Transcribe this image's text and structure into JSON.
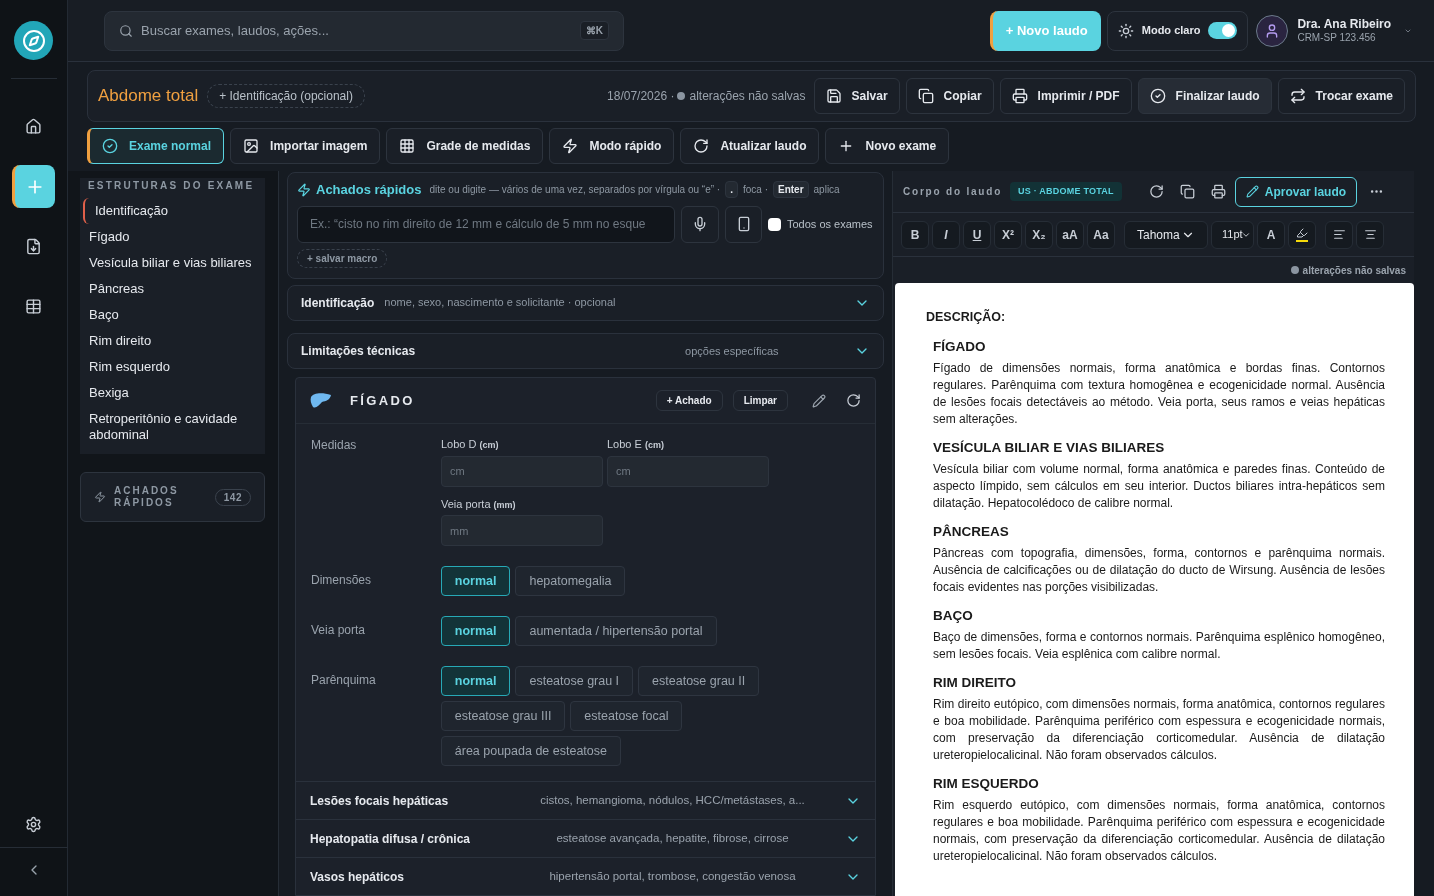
{
  "search": {
    "placeholder": "Buscar exames, laudos, ações...",
    "shortcut": "⌘K"
  },
  "topbar": {
    "new_button": "+ Novo laudo",
    "theme_toggle": {
      "label": "Modo claro",
      "on": true
    },
    "user": {
      "name": "Dra. Ana Ribeiro",
      "subtitle": "CRM-SP 123.456"
    }
  },
  "rail": [
    {
      "kind": "home",
      "selected": false
    },
    {
      "kind": "plus",
      "selected": true
    },
    {
      "kind": "file",
      "selected": false
    },
    {
      "kind": "table",
      "selected": false
    }
  ],
  "header": {
    "title": "Abdome total",
    "id_chip": "+ Identificação (opcional)",
    "date": "18/07/2026 ·",
    "status": "alterações não salvas",
    "buttons": [
      {
        "kind": "save",
        "label": "Salvar"
      },
      {
        "kind": "copy",
        "label": "Copiar"
      },
      {
        "kind": "print",
        "label": "Imprimir / PDF"
      },
      {
        "kind": "check",
        "label": "Finalizar laudo"
      },
      {
        "kind": "swap",
        "label": "Trocar exame"
      }
    ]
  },
  "actions": [
    {
      "kind": "check",
      "label": "Exame normal",
      "selected": true
    },
    {
      "kind": "image",
      "label": "Importar imagem",
      "selected": false
    },
    {
      "kind": "grid",
      "label": "Grade de medidas",
      "selected": false
    },
    {
      "kind": "bolt",
      "label": "Modo rápido",
      "selected": false
    },
    {
      "kind": "refresh",
      "label": "Atualizar laudo",
      "selected": false
    },
    {
      "kind": "plus",
      "label": "Novo exame",
      "selected": false
    }
  ],
  "structures": {
    "title": "ESTRUTURAS DO EXAME",
    "items": [
      {
        "label": "Identificação",
        "selected": true
      },
      {
        "label": "Fígado",
        "selected": false
      },
      {
        "label": "Vesícula biliar e vias biliares",
        "selected": false
      },
      {
        "label": "Pâncreas",
        "selected": false
      },
      {
        "label": "Baço",
        "selected": false
      },
      {
        "label": "Rim direito",
        "selected": false
      },
      {
        "label": "Rim esquerdo",
        "selected": false
      },
      {
        "label": "Bexiga",
        "selected": false
      },
      {
        "label": "Retroperitônio e cavidade abdominal",
        "selected": false
      }
    ],
    "quick": {
      "label": "ACHADOS RÁPIDOS",
      "count": "142"
    }
  },
  "quick_findings": {
    "title": "Achados rápidos",
    "hint": "dite ou digite — vários de uma vez, separados por vírgula ou “e” ·",
    "key1": ".",
    "hint2": "foca ·",
    "key2": "Enter",
    "hint3": "aplica",
    "placeholder": "Ex.: “cisto no rim direito de 12 mm e cálculo de 5 mm no esque",
    "all_exams": {
      "label": "Todos os exames",
      "checked": false
    },
    "macro": "+ salvar macro"
  },
  "sections": [
    {
      "title": "Identificação",
      "hint": "nome, sexo, nascimento e solicitante · opcional",
      "expanded": false
    },
    {
      "title": "Limitações técnicas",
      "hint": "opções específicas",
      "expanded": false
    }
  ],
  "organ": {
    "title": "FÍGADO",
    "add": "+ Achado",
    "clear": "Limpar",
    "measures_label": "Medidas",
    "measures": [
      {
        "label": "Lobo D",
        "unit": "(cm)",
        "placeholder": "cm"
      },
      {
        "label": "Lobo E",
        "unit": "(cm)",
        "placeholder": "cm"
      },
      {
        "label": "Veia porta",
        "unit": "(mm)",
        "placeholder": "mm"
      }
    ],
    "groups": [
      {
        "label": "Dimensões",
        "options": [
          {
            "label": "normal",
            "selected": true
          },
          {
            "label": "hepatomegalia",
            "selected": false
          }
        ]
      },
      {
        "label": "Veia porta",
        "options": [
          {
            "label": "normal",
            "selected": true
          },
          {
            "label": "aumentada / hipertensão portal",
            "selected": false
          }
        ]
      },
      {
        "label": "Parênquima",
        "options": [
          {
            "label": "normal",
            "selected": true
          },
          {
            "label": "esteatose grau I",
            "selected": false
          },
          {
            "label": "esteatose grau II",
            "selected": false
          },
          {
            "label": "esteatose grau III",
            "selected": false
          },
          {
            "label": "esteatose focal",
            "selected": false
          },
          {
            "label": "área poupada de esteatose",
            "selected": false
          }
        ]
      }
    ],
    "subsections": [
      {
        "title": "Lesões focais hepáticas",
        "hint": "cistos, hemangioma, nódulos, HCC/metástases, a...",
        "expanded": false
      },
      {
        "title": "Hepatopatia difusa / crônica",
        "hint": "esteatose avançada, hepatite, fibrose, cirrose",
        "expanded": false
      },
      {
        "title": "Vasos hepáticos",
        "hint": "hipertensão portal, trombose, congestão venosa",
        "expanded": false
      }
    ]
  },
  "editor": {
    "title": "Corpo do laudo",
    "tag": "US · ABDOME TOTAL",
    "approve": "Aprovar laudo",
    "format_buttons": [
      "B",
      "I",
      "U",
      "X²",
      "X₂",
      "aA",
      "Aa"
    ],
    "font": "Tahoma",
    "size": "11pt",
    "color_button": "A",
    "status": "alterações não salvas",
    "document": {
      "heading": "DESCRIÇÃO:",
      "sections": [
        {
          "title": "FÍGADO",
          "text": "Fígado de dimensões normais, forma anatômica e bordas finas. Contornos regulares. Parênquima com textura homogênea e ecogenicidade normal. Ausência de lesões focais detectáveis ao método. Veia porta, seus ramos e veias hepáticas sem alterações."
        },
        {
          "title": "VESÍCULA BILIAR E VIAS BILIARES",
          "text": "Vesícula biliar com volume normal, forma anatômica e paredes finas. Conteúdo de aspecto límpido, sem cálculos em seu interior. Ductos biliares intra-hepáticos sem dilatação. Hepatocolédoco de calibre normal."
        },
        {
          "title": "PÂNCREAS",
          "text": "Pâncreas com topografia, dimensões, forma, contornos e parênquima normais. Ausência de calcificações ou de dilatação do ducto de Wirsung. Ausência de lesões focais evidentes nas porções visibilizadas."
        },
        {
          "title": "BAÇO",
          "text": "Baço de dimensões, forma e contornos normais. Parênquima esplênico homogêneo, sem lesões focais. Veia esplênica com calibre normal."
        },
        {
          "title": "RIM DIREITO",
          "text": "Rim direito eutópico, com dimensões normais, forma anatômica, contornos regulares e boa mobilidade. Parênquima periférico com espessura e ecogenicidade normais, com preservação da diferenciação corticomedular. Ausência de dilatação ureteropielocalicinal. Não foram observados cálculos."
        },
        {
          "title": "RIM ESQUERDO",
          "text": "Rim esquerdo eutópico, com dimensões normais, forma anatômica, contornos regulares e boa mobilidade. Parênquima periférico com espessura e ecogenicidade normais, com preservação da diferenciação corticomedular. Ausência de dilatação ureteropielocalicinal. Não foram observados cálculos."
        }
      ]
    }
  }
}
